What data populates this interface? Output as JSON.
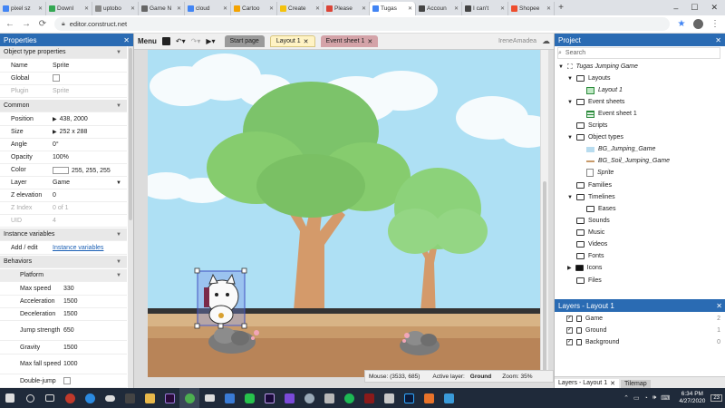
{
  "browser": {
    "tabs": [
      {
        "label": "pixel sz",
        "color": "#4285f4"
      },
      {
        "label": "Downl",
        "color": "#34a853"
      },
      {
        "label": "uptobo",
        "color": "#888888"
      },
      {
        "label": "Game N",
        "color": "#666666"
      },
      {
        "label": "cloud",
        "color": "#4285f4"
      },
      {
        "label": "Cartoo",
        "color": "#f4a300"
      },
      {
        "label": "Create",
        "color": "#f4c20d"
      },
      {
        "label": "Please",
        "color": "#db4437"
      },
      {
        "label": "Tugas",
        "color": "#4285f4",
        "active": true
      },
      {
        "label": "Accoun",
        "color": "#444444"
      },
      {
        "label": "I can't",
        "color": "#444444"
      },
      {
        "label": "Shopee",
        "color": "#ee4d2d"
      }
    ],
    "new_tab": "+",
    "url": "editor.construct.net"
  },
  "left_panel": {
    "title": "Properties",
    "section_object_type": "Object type properties",
    "name_label": "Name",
    "name_value": "Sprite",
    "global_label": "Global",
    "plugin_label": "Plugin",
    "plugin_value": "Sprite",
    "section_common": "Common",
    "position_label": "Position",
    "position_value": "438, 2000",
    "size_label": "Size",
    "size_value": "252 x 288",
    "angle_label": "Angle",
    "angle_value": "0°",
    "opacity_label": "Opacity",
    "opacity_value": "100%",
    "color_label": "Color",
    "color_value": "255, 255, 255",
    "layer_label": "Layer",
    "layer_value": "Game",
    "zelev_label": "Z elevation",
    "zelev_value": "0",
    "zindex_label": "Z Index",
    "zindex_value": "0 of 1",
    "uid_label": "UID",
    "uid_value": "4",
    "section_instance": "Instance variables",
    "addedit_label": "Add / edit",
    "addedit_link": "Instance variables",
    "section_behaviors": "Behaviors",
    "platform_label": "Platform",
    "maxspeed_label": "Max speed",
    "maxspeed_value": "330",
    "accel_label": "Acceleration",
    "accel_value": "1500",
    "decel_label": "Deceleration",
    "decel_value": "1500",
    "jump_label": "Jump strength",
    "jump_value": "650",
    "gravity_label": "Gravity",
    "gravity_value": "1500",
    "maxfall_label": "Max fall speed",
    "maxfall_value": "1000",
    "doublejump_label": "Double-jump"
  },
  "center": {
    "menu_label": "Menu",
    "tab_start": "Start page",
    "tab_layout": "Layout 1",
    "tab_events": "Event sheet 1",
    "username": "IreneAmadea",
    "status_mouse": "Mouse: (3533, 685)",
    "status_layer_label": "Active layer:",
    "status_layer_value": "Ground",
    "status_zoom": "Zoom: 35%"
  },
  "right_panel": {
    "title": "Project",
    "search_placeholder": "Search",
    "project_name": "Tugas Jumping Game",
    "tree": {
      "layouts": "Layouts",
      "layout1": "Layout 1",
      "event_sheets": "Event sheets",
      "event_sheet1": "Event sheet 1",
      "scripts": "Scripts",
      "object_types": "Object types",
      "bg_jumping": "BG_Jumping_Game",
      "bg_soil": "BG_Soil_Jumping_Game",
      "sprite": "Sprite",
      "families": "Families",
      "timelines": "Timelines",
      "eases": "Eases",
      "sounds": "Sounds",
      "music": "Music",
      "videos": "Videos",
      "fonts": "Fonts",
      "icons": "Icons",
      "files": "Files"
    },
    "layers_title": "Layers - Layout 1",
    "layers": [
      {
        "name": "Game",
        "num": "2"
      },
      {
        "name": "Ground",
        "num": "1"
      },
      {
        "name": "Background",
        "num": "0"
      }
    ],
    "bottom_tab_layers": "Layers - Layout 1",
    "bottom_tab_tilemap": "Tilemap"
  },
  "taskbar": {
    "time": "6:34 PM",
    "date": "4/27/2020",
    "notif": "23"
  }
}
